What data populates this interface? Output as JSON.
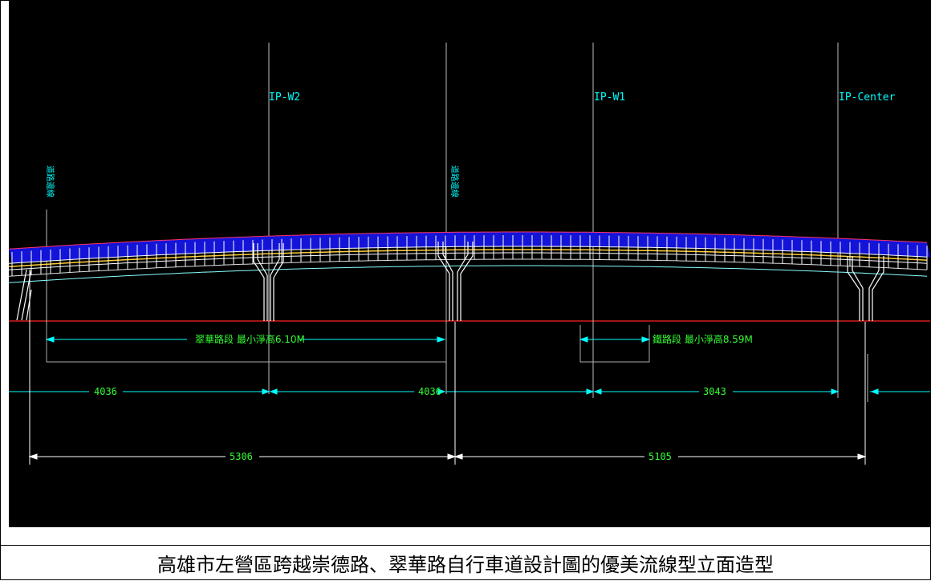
{
  "labels": {
    "ip_w2": "IP-W2",
    "ip_w1": "IP-W1",
    "ip_center": "IP-Center",
    "left_vertical": "道路邊線",
    "mid_vertical": "道路邊線",
    "clearance_left": "翠華路段 最小淨高6.10M",
    "clearance_right": "鐵路段 最小淨高8.59M"
  },
  "dimensions": {
    "row1": [
      "4036",
      "4036",
      "3043"
    ],
    "row2": [
      "5306",
      "5105"
    ]
  },
  "caption": "高雄市左營區跨越崇德路、翠華路自行車道設計圖的優美流線型立面造型"
}
